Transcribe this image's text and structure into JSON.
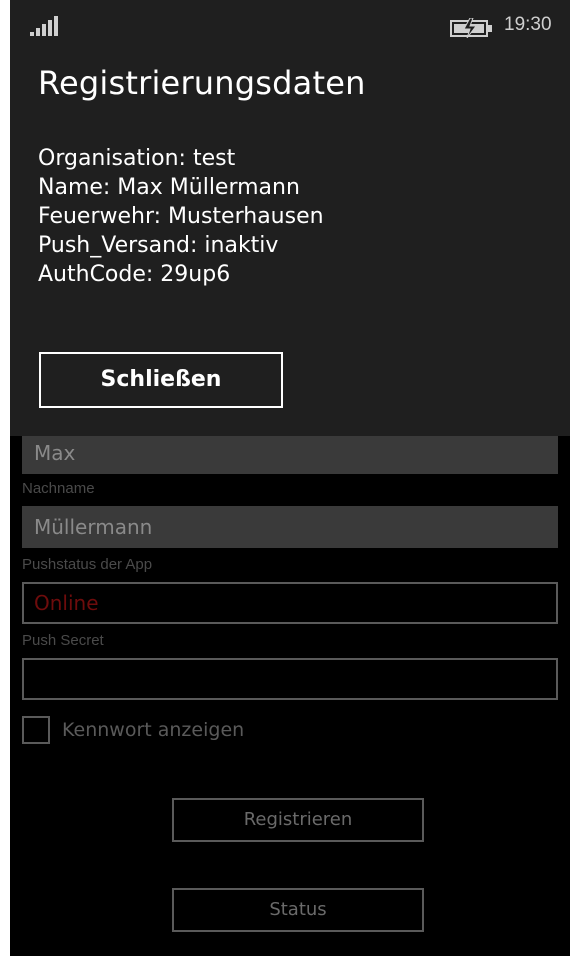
{
  "status_bar": {
    "time": "19:30",
    "signal_icon": "signal-bars-icon",
    "battery_icon": "battery-charging-icon"
  },
  "dialog": {
    "title": "Registrierungsdaten",
    "lines": [
      "Organisation: test",
      "Name: Max Müllermann",
      "Feuerwehr: Musterhausen",
      "Push_Versand: inaktiv",
      "AuthCode: 29up6"
    ],
    "close_label": "Schließen"
  },
  "form": {
    "vorname_value": "Max",
    "nachname_label": "Nachname",
    "nachname_value": "Müllermann",
    "pushstatus_label": "Pushstatus der App",
    "pushstatus_value": "Online",
    "push_secret_label": "Push Secret",
    "push_secret_value": "",
    "show_password_label": "Kennwort anzeigen",
    "show_password_checked": false,
    "register_label": "Registrieren",
    "status_label": "Status"
  },
  "colors": {
    "dialog_bg": "#1f1f1f",
    "page_bg": "#000000",
    "status_online": "#6e0c0c"
  }
}
